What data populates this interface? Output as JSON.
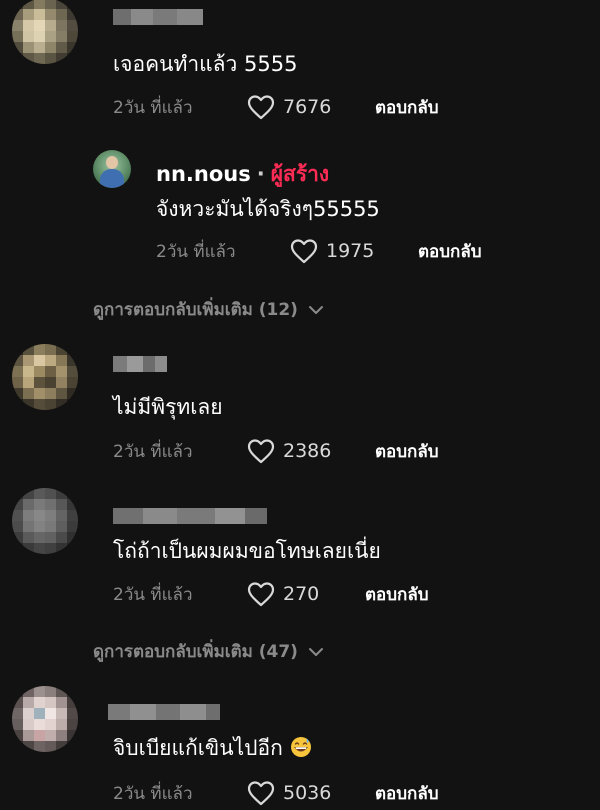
{
  "comments": [
    {
      "text": "เจอคนทำแล้ว 5555",
      "time": "2วัน ที่แล้ว",
      "likes": "7676",
      "reply_label": "ตอบกลับ"
    },
    {
      "text": "ไม่มีพิรุทเลย",
      "time": "2วัน ที่แล้ว",
      "likes": "2386",
      "reply_label": "ตอบกลับ"
    },
    {
      "text": "โถ่ถ้าเป็นผมผมขอโทษเลยเนี่ย",
      "time": "2วัน ที่แล้ว",
      "likes": "270",
      "reply_label": "ตอบกลับ"
    },
    {
      "text": "จิบเบียแก้เขินไปอีก",
      "time": "2วัน ที่แล้ว",
      "likes": "5036",
      "reply_label": "ตอบกลับ"
    }
  ],
  "creator_reply": {
    "username": "nn.nous",
    "separator": "·",
    "badge": "ผู้สร้าง",
    "text": "จังหวะมันได้จริงๆ55555",
    "time": "2วัน ที่แล้ว",
    "likes": "1975",
    "reply_label": "ตอบกลับ"
  },
  "more_replies": [
    "ดูการตอบกลับเพิ่มเติม (12)",
    "ดูการตอบกลับเพิ่มเติม (47)"
  ],
  "colors": {
    "background": "#121212",
    "secondary_text": "#8a8a8a",
    "creator_badge": "#fe2c55"
  },
  "icons": {
    "like": "heart-outline-icon",
    "expand": "chevron-down-icon",
    "emoji": "grinning-sweat-emoji-icon"
  }
}
